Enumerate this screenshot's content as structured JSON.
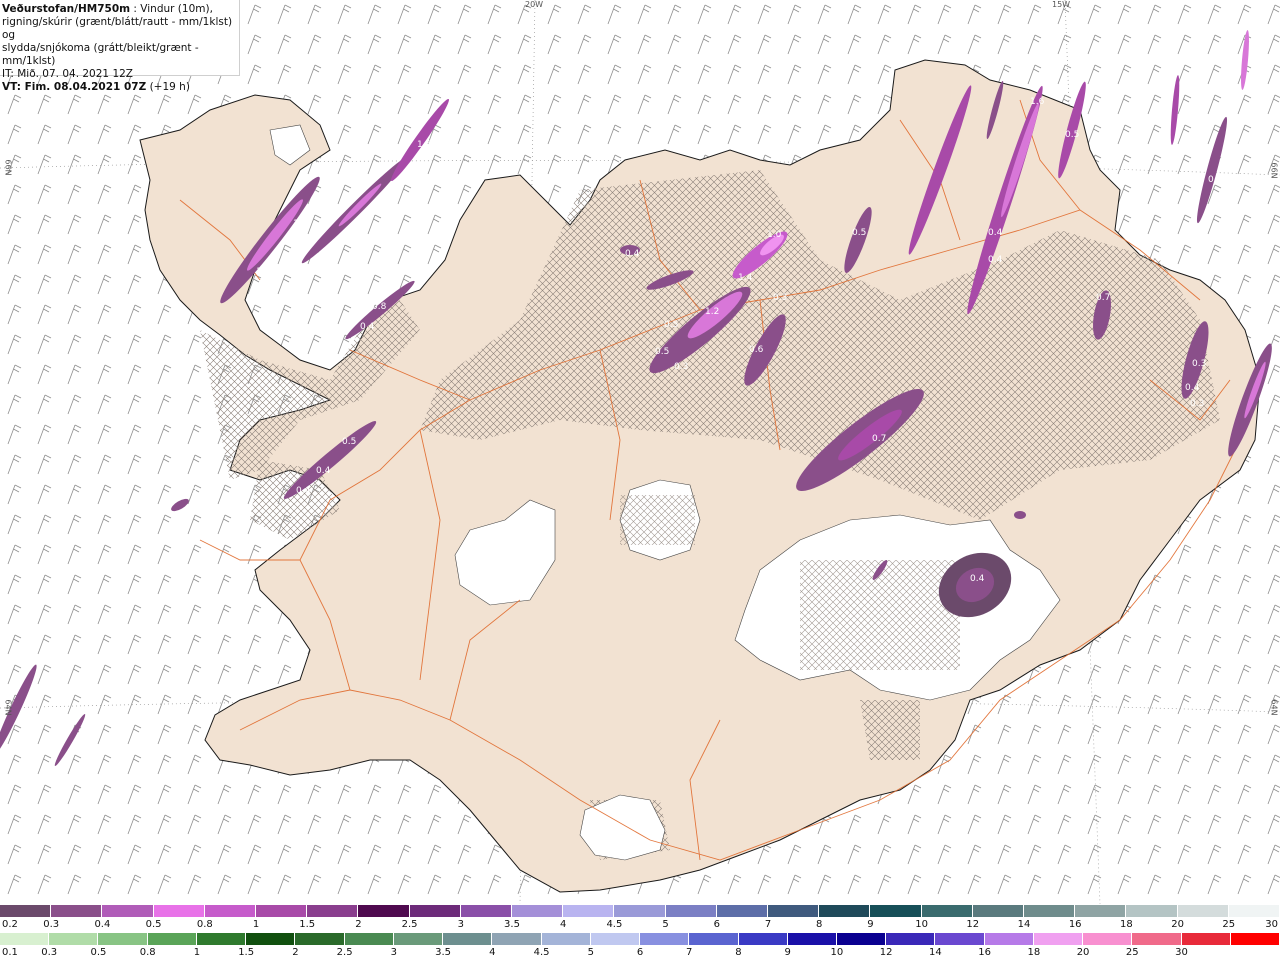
{
  "header": {
    "source": "Veðurstofan/HM750m",
    "line1_rest": " : Vindur (10m),",
    "line2": "rigning/skúrir (grænt/blátt/rautt - mm/1klst) og",
    "line3": "slydda/snjókoma (grátt/bleikt/grænt - mm/1klst)",
    "issued": "IT: Mið. 07. 04. 2021 12Z",
    "valid_bold": "VT: Fim. 08.04.2021 07Z",
    "valid_rest": " (+19 h)"
  },
  "graticule_labels": [
    "20W",
    "15W",
    "66N",
    "66N",
    "64N",
    "64N"
  ],
  "precip_labels": [
    "1.8",
    "1.8",
    "1.1",
    "1.5",
    "0.8",
    "0.4",
    "0.5",
    "0.4",
    "0.4",
    "0.3",
    "0.4",
    "1.2",
    "0.5",
    "0.5",
    "0.3",
    "1.0",
    "1.4",
    "0.3",
    "0.6",
    "0.5",
    "0.7",
    "0.4",
    "0.4",
    "0.7",
    "0.4",
    "1.6",
    "0.5",
    "0.4",
    "0.3",
    "0.4",
    "0.3"
  ],
  "colors": {
    "land": "#f2e2d2",
    "sea": "#ffffff",
    "glacier": "#ffffff",
    "roads": "#e06a2c",
    "coast": "#1a1a1a",
    "wind_barb": "#707070"
  },
  "legend_top": {
    "colors": [
      "#6b4a6b",
      "#8a4f8a",
      "#b05cb8",
      "#e872e8",
      "#c65bcb",
      "#a84aa8",
      "#8a3e8e",
      "#4f0a4f",
      "#6d2b7a",
      "#8a4fa8",
      "#a48fd8",
      "#b9b4f0",
      "#9a9ad8",
      "#7b7fc4",
      "#5d6ea8",
      "#3f5a7e",
      "#1f4a5a",
      "#174f58",
      "#3a6b6e",
      "#5a7a7e",
      "#6f8c8c",
      "#8fa4a4",
      "#b4c4c4",
      "#d4dcdc",
      "#f0f4f4"
    ],
    "labels": [
      "0.2",
      "0.3",
      "0.4",
      "0.5",
      "0.8",
      "1",
      "1.5",
      "2",
      "2.5",
      "3",
      "3.5",
      "4",
      "4.5",
      "5",
      "6",
      "7",
      "8",
      "9",
      "10",
      "12",
      "14",
      "16",
      "18",
      "20",
      "25",
      "30"
    ]
  },
  "legend_bottom": {
    "colors": [
      "#d8f0d0",
      "#b0dca8",
      "#88c484",
      "#5aa458",
      "#2f7a2e",
      "#11500f",
      "#2a6a2a",
      "#4a8a52",
      "#6a9a7a",
      "#6d8f8f",
      "#8fa4b4",
      "#a4b4d8",
      "#c0c8f0",
      "#8890e0",
      "#5a64d0",
      "#3a3ac4",
      "#1a10a8",
      "#0a0090",
      "#3a28b8",
      "#6a48d0",
      "#b67ae8",
      "#f0a0f0",
      "#f890d0",
      "#f06a8a",
      "#e82a3a",
      "#ff0000"
    ],
    "labels": [
      "0.1",
      "0.3",
      "0.5",
      "0.8",
      "1",
      "1.5",
      "2",
      "2.5",
      "3",
      "3.5",
      "4",
      "4.5",
      "5",
      "6",
      "7",
      "8",
      "9",
      "10",
      "12",
      "14",
      "16",
      "18",
      "20",
      "25",
      "30"
    ]
  }
}
